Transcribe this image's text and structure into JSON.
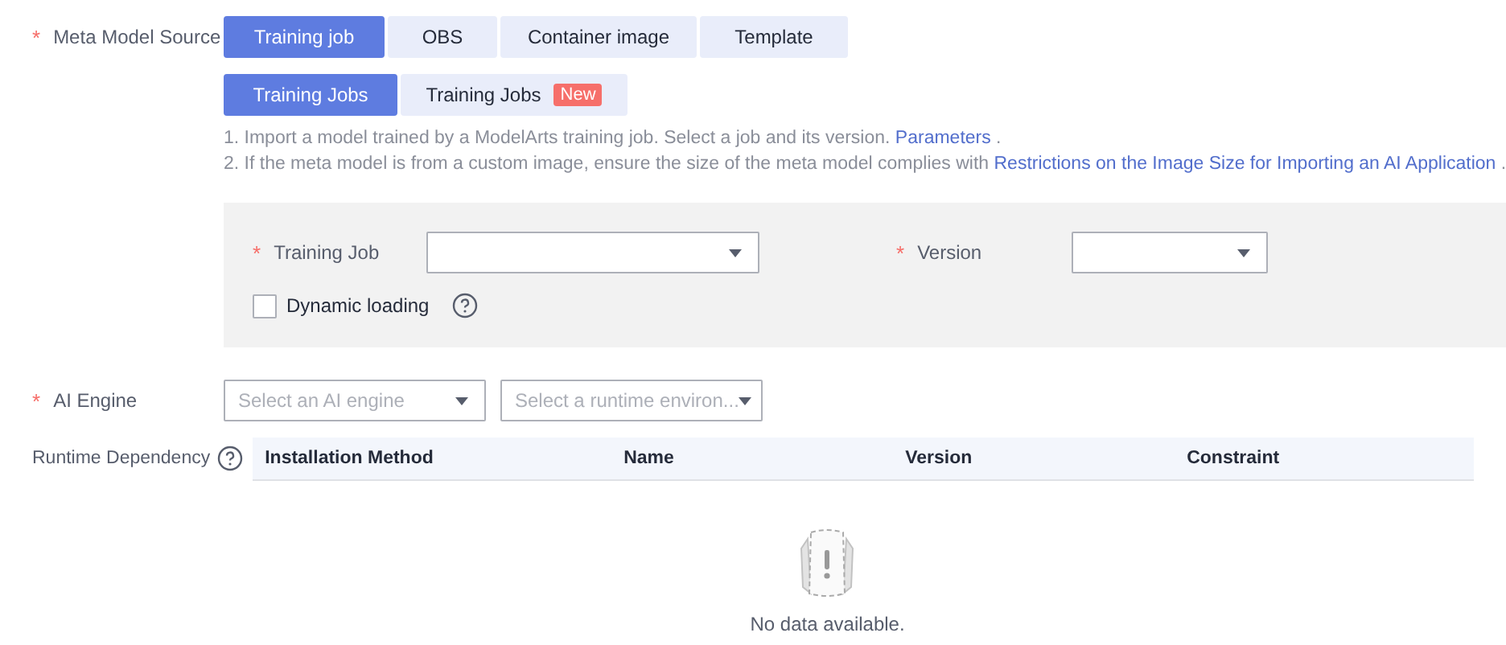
{
  "meta_model_source": {
    "label": "Meta Model Source",
    "required_mark": "*",
    "tabs": [
      {
        "label": "Training job",
        "selected": true
      },
      {
        "label": "OBS",
        "selected": false
      },
      {
        "label": "Container image",
        "selected": false
      },
      {
        "label": "Template",
        "selected": false
      }
    ],
    "sub_tabs": [
      {
        "label": "Training Jobs",
        "selected": true
      },
      {
        "label": "Training Jobs",
        "selected": false,
        "badge": "New"
      }
    ],
    "notes": [
      {
        "text": "1. Import a model trained by a ModelArts training job. Select a job and its version.",
        "link": "Parameters",
        "after": " ."
      },
      {
        "text": "2. If the meta model is from a custom image, ensure the size of the meta model complies with",
        "link": "Restrictions on the Image Size for Importing an AI Application",
        "after": " ."
      }
    ],
    "panel": {
      "training_job": {
        "label": "Training Job",
        "required_mark": "*"
      },
      "version": {
        "label": "Version",
        "required_mark": "*"
      },
      "dynamic_loading": {
        "label": "Dynamic loading",
        "checked": false
      }
    }
  },
  "ai_engine": {
    "label": "AI Engine",
    "required_mark": "*",
    "engine_placeholder": "Select an AI engine",
    "runtime_placeholder": "Select a runtime environ..."
  },
  "runtime_dependency": {
    "label": "Runtime Dependency",
    "columns": [
      "Installation Method",
      "Name",
      "Version",
      "Constraint"
    ],
    "empty_text": "No data available."
  }
}
